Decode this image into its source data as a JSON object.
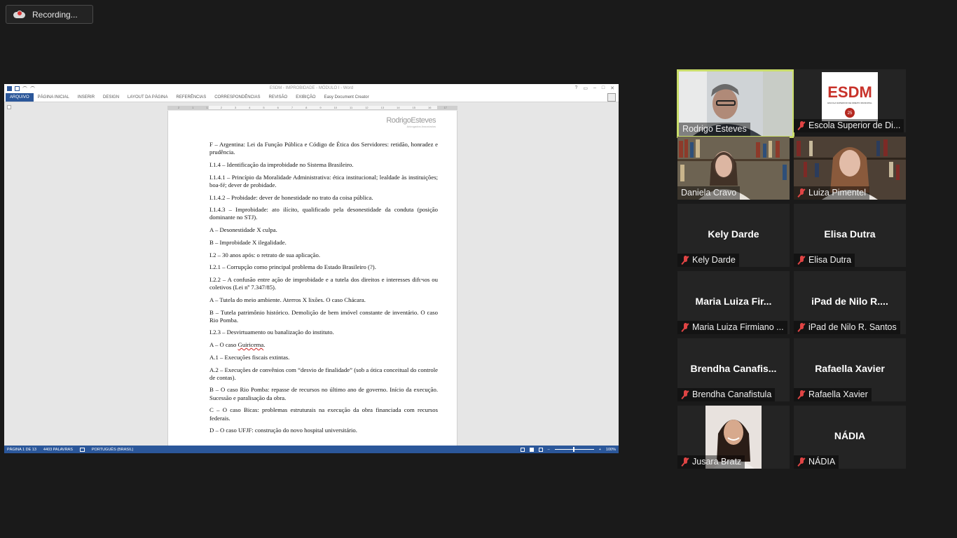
{
  "recording": {
    "label": "Recording..."
  },
  "word": {
    "title": "ESDM - IMPROBIDADE - MÓDULO I - Word",
    "tabs": [
      "ARQUIVO",
      "PÁGINA INICIAL",
      "INSERIR",
      "DESIGN",
      "LAYOUT DA PÁGINA",
      "REFERÊNCIAS",
      "CORRESPONDÊNCIAS",
      "REVISÃO",
      "EXIBIÇÃO",
      "Easy Document Creator"
    ],
    "ruler_labels": [
      "2",
      "1",
      "1",
      "2",
      "3",
      "4",
      "5",
      "6",
      "7",
      "8",
      "9",
      "10",
      "11",
      "12",
      "13",
      "14",
      "15",
      "16",
      "17"
    ],
    "logo_name": "RodrigoEsteves",
    "logo_sub": "Advogados Associados",
    "paragraphs": [
      "F – Argentina: Lei da Função Pública e Código de Ética dos Servidores: retidão, honradez e prudência.",
      "I.1.4 – Identificação da improbidade no Sistema Brasileiro.",
      "I.1.4.1 – Princípio da Moralidade Administrativa: ética institucional; lealdade às instituições; boa-fé; dever de probidade.",
      "I.1.4.2 – Probidade: dever de honestidade no trato da coisa pública.",
      "I.1.4.3 – Improbidade: ato ilícito, qualificado pela desonestidade da conduta (posição dominante no STJ).",
      "A – Desonestidade X culpa.",
      "B – Improbidade X ilegalidade.",
      "I.2 – 30 anos após: o retrato de sua aplicação.",
      "I.2.1 – Corrupção como principal problema do Estado Brasileiro (?).",
      "I.2.2 – A confusão entre ação de improbidade e a tutela dos direitos e interesses difusos ou coletivos (Lei nº 7.347/85).",
      "A – Tutela do meio ambiente. Aterros X lixões. O caso Chácara.",
      "B – Tutela patrimônio histórico. Demolição de bem imóvel constante de inventário. O caso Rio Pomba.",
      "I.2.3 – Desvirtuamento ou banalização do instituto.",
      "A – O caso Guiricema.",
      "A.1 – Execuções fiscais extintas.",
      "A.2 – Execuções de convênios com “desvio de finalidade” (sob a ótica conceitual do controle de contas).",
      "B – O caso Rio Pomba: repasse de recursos no último ano de governo. Início da execução. Sucessão e paralisação da obra.",
      "C – O caso Bicas: problemas estruturais na execução da obra financiada com recursos federais.",
      "D – O caso UFJF: construção do novo hospital universitário."
    ],
    "status": {
      "page": "PÁGINA 1 DE 13",
      "words": "4403 PALAVRAS",
      "language": "PORTUGUÊS (BRASIL)",
      "zoom": "100%"
    }
  },
  "participants": [
    {
      "name": "Rodrigo Esteves",
      "video": "video-rodrigo",
      "muted": false,
      "active": true
    },
    {
      "name": "Escola Superior de Di...",
      "video": "video-esdm",
      "muted": true
    },
    {
      "name": "Daniela Cravo",
      "video": "video-daniela",
      "muted": false
    },
    {
      "name": "Luiza Pimentel",
      "video": "video-luiza",
      "muted": true
    },
    {
      "name": "Kely Darde",
      "center": "Kely Darde",
      "muted": true
    },
    {
      "name": "Elisa Dutra",
      "center": "Elisa Dutra",
      "muted": true
    },
    {
      "name": "Maria Luiza Firmiano ...",
      "center": "Maria Luiza Fir...",
      "muted": true
    },
    {
      "name": "iPad de Nilo R. Santos",
      "center": "iPad de Nilo R....",
      "muted": true
    },
    {
      "name": "Brendha Canafistula",
      "center": "Brendha  Canafis...",
      "muted": true
    },
    {
      "name": "Rafaella Xavier",
      "center": "Rafaella Xavier",
      "muted": true
    },
    {
      "name": "Jusara Bratz",
      "video": "video-jusara",
      "muted": true
    },
    {
      "name": "NÁDIA",
      "center": "NÁDIA",
      "muted": true
    }
  ],
  "esdm_logo": {
    "text": "ESDM",
    "sub": "ESCOLA SUPERIOR DE DIREITO MUNICIPAL",
    "badge": "25"
  },
  "colors": {
    "background": "#1a1a1a",
    "tile": "#242424",
    "active_border": "#c9dd6a",
    "word_blue": "#2b579a",
    "mute_red": "#e04444"
  }
}
